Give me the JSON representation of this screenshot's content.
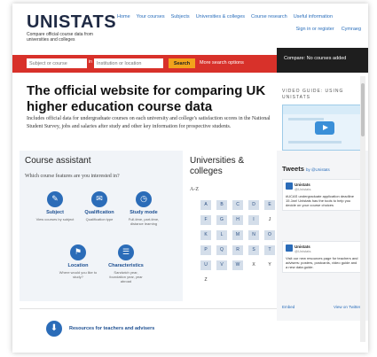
{
  "header": {
    "logo": "UNISTATS",
    "tagline": "Compare official course data from universities and colleges",
    "nav": [
      "Home",
      "Your courses",
      "Subjects",
      "Universities & colleges",
      "Course research",
      "Useful information"
    ],
    "sign_in": "Sign in or register",
    "language": "Cymraeg"
  },
  "search": {
    "course_placeholder": "Subject or course",
    "in_word": "in",
    "institution_placeholder": "Institution or location",
    "button": "Search",
    "more": "More search options"
  },
  "compare": {
    "text": "Compare: No courses added"
  },
  "hero": {
    "title": "The official website for comparing UK higher education course data",
    "description": "Includes official data for undergraduate courses on each university and college's satisfaction scores in the National Student Survey, jobs and salaries after study and other key information for prospective students."
  },
  "video": {
    "label": "VIDEO GUIDE: USING UNISTATS"
  },
  "course_assistant": {
    "title": "Course assistant",
    "question": "Which course features are you interested in?",
    "features": [
      {
        "icon": "subject-icon",
        "glyph": "✎",
        "label": "Subject",
        "desc": "View courses by subject"
      },
      {
        "icon": "qualification-icon",
        "glyph": "✉",
        "label": "Qualification",
        "desc": "Qualification type"
      },
      {
        "icon": "clock-icon",
        "glyph": "◷",
        "label": "Study mode",
        "desc": "Full-time, part-time, distance learning"
      },
      {
        "icon": "location-pin-icon",
        "glyph": "⚑",
        "label": "Location",
        "desc": "Where would you like to study?"
      },
      {
        "icon": "characteristics-icon",
        "glyph": "☰",
        "label": "Characteristics",
        "desc": "Sandwich year, foundation year, year abroad"
      }
    ]
  },
  "universities": {
    "title": "Universities & colleges",
    "az": "A-Z",
    "letters": [
      "A",
      "B",
      "C",
      "D",
      "E",
      "F",
      "G",
      "H",
      "I",
      "J",
      "K",
      "L",
      "M",
      "N",
      "O",
      "P",
      "Q",
      "R",
      "S",
      "T",
      "U",
      "V",
      "W",
      "X",
      "Y",
      "Z"
    ]
  },
  "tweets": {
    "title": "Tweets",
    "by": "by @Unistats",
    "items": [
      {
        "name": "Unistats",
        "handle": "@Unistats",
        "text": "#UCAS undergraduate application deadline 15 Jan! Unistats has the tools to help you decide on your course choices"
      },
      {
        "name": "Unistats",
        "handle": "@Unistats",
        "text": "Visit our new resources page for teachers and advisers: posters, postcards, video guide and a new data guide."
      }
    ],
    "embed": "Embed",
    "view": "View on Twitter"
  },
  "resources": {
    "link": "Resources for teachers and advisers",
    "glyph": "⬇"
  }
}
